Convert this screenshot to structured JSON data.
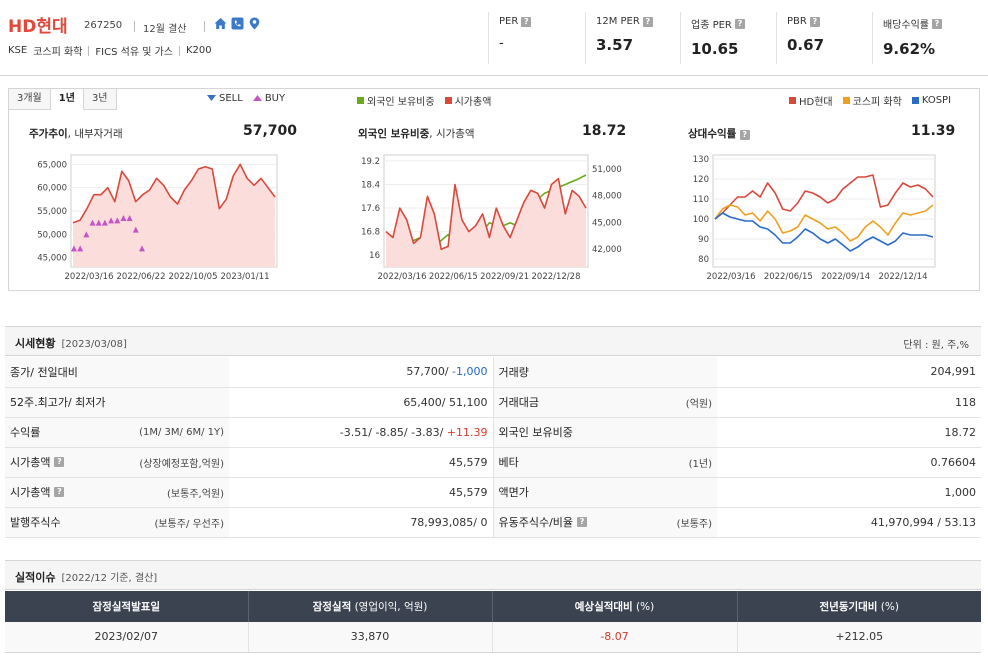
{
  "company": {
    "name": "HD현대",
    "code": "267250",
    "fiscal": "12월 결산",
    "market": "KSE",
    "kospi_sector": "코스피 화학",
    "fics_sector": "FICS 석유 및 가스",
    "index": "K200"
  },
  "metrics": [
    {
      "label": "PER",
      "value": "-"
    },
    {
      "label": "12M PER",
      "value": "3.57"
    },
    {
      "label": "업종 PER",
      "value": "10.65"
    },
    {
      "label": "PBR",
      "value": "0.67"
    },
    {
      "label": "배당수익률",
      "value": "9.62%"
    }
  ],
  "tabs": [
    "3개월",
    "1년",
    "3년"
  ],
  "active_tab": "1년",
  "legends": {
    "chart1": [
      "SELL",
      "BUY"
    ],
    "chart2": [
      "외국인 보유비중",
      "시가총액"
    ],
    "chart3": [
      "HD현대",
      "코스피 화학",
      "KOSPI"
    ]
  },
  "colors": {
    "red": "#d9493b",
    "green": "#6aaa1e",
    "orange": "#f0a020",
    "blue": "#2a6dc7",
    "sell": "#3a6fc8",
    "buy": "#c555c5"
  },
  "charts": {
    "c1": {
      "title_main": "주가추이",
      "title_sub": ", 내부자거래",
      "value": "57,700"
    },
    "c2": {
      "title_main": "외국인 보유비중",
      "title_sub": ", 시가총액",
      "value": "18.72"
    },
    "c3": {
      "title_main": "상대수익률",
      "title_sub": "",
      "value": "11.39"
    }
  },
  "chart_data": [
    {
      "type": "line",
      "title": "주가추이, 내부자거래",
      "x": [
        "2022/03/16",
        "2022/06/22",
        "2022/10/05",
        "2023/01/11"
      ],
      "ylim": [
        43000,
        67000
      ],
      "yticks": [
        "65,000",
        "60,000",
        "55,000",
        "50,000",
        "45,000"
      ],
      "series": [
        {
          "name": "주가",
          "values": [
            52500,
            53000,
            55500,
            58500,
            58500,
            60000,
            57000,
            63500,
            61500,
            57000,
            58500,
            59500,
            62000,
            60500,
            58000,
            56500,
            59500,
            61500,
            64000,
            64500,
            64000,
            55500,
            57500,
            62500,
            65000,
            62000,
            60500,
            62000,
            60000,
            58000
          ]
        },
        {
          "name": "BUY",
          "values": [
            47000,
            47000,
            50000,
            52500,
            52500,
            52500,
            53000,
            53000,
            53500,
            53500,
            51000,
            47000
          ]
        }
      ]
    },
    {
      "type": "line",
      "title": "외국인 보유비중, 시가총액",
      "x": [
        "2022/03/16",
        "2022/06/15",
        "2022/09/21",
        "2022/12/28"
      ],
      "ylim": [
        15.6,
        19.4
      ],
      "yticks": [
        "19.2",
        "18.4",
        "17.6",
        "16.8",
        "16"
      ],
      "y2ticks": [
        "51,000",
        "48,000",
        "45,000",
        "42,000"
      ],
      "series": [
        {
          "name": "외국인 보유비중",
          "values": [
            16.4,
            16.3,
            16.2,
            16.4,
            16.5,
            16.6,
            16.3,
            16.2,
            16.5,
            16.7,
            16.4,
            16.2,
            16.1,
            16.5,
            16.8,
            17.1,
            17.0,
            17.0,
            17.1,
            17.0,
            17.2,
            17.6,
            17.9,
            18.1,
            18.2,
            18.3,
            18.4,
            18.5,
            18.6,
            18.72
          ]
        },
        {
          "name": "시가총액",
          "values": [
            16.8,
            16.6,
            17.6,
            17.2,
            16.4,
            16.6,
            18.0,
            17.4,
            16.2,
            16.3,
            18.4,
            17.2,
            16.8,
            17.0,
            17.4,
            16.6,
            17.6,
            17.0,
            16.6,
            17.2,
            17.8,
            18.2,
            18.1,
            17.6,
            18.4,
            18.6,
            17.4,
            18.2,
            18.0,
            17.6
          ]
        }
      ]
    },
    {
      "type": "line",
      "title": "상대수익률",
      "x": [
        "2022/03/16",
        "2022/06/15",
        "2022/09/14",
        "2022/12/14"
      ],
      "ylim": [
        76,
        132
      ],
      "yticks": [
        "130",
        "120",
        "110",
        "100",
        "90",
        "80"
      ],
      "series": [
        {
          "name": "HD현대",
          "values": [
            100,
            103,
            107,
            111,
            111,
            114,
            111,
            118,
            113,
            105,
            104,
            108,
            114,
            113,
            111,
            108,
            110,
            115,
            118,
            121,
            121,
            122,
            106,
            107,
            113,
            118,
            116,
            117,
            115,
            111
          ]
        },
        {
          "name": "코스피 화학",
          "values": [
            100,
            105,
            107,
            106,
            102,
            103,
            99,
            104,
            100,
            93,
            94,
            96,
            102,
            100,
            98,
            95,
            96,
            93,
            89,
            91,
            96,
            99,
            96,
            92,
            98,
            103,
            102,
            103,
            104,
            107
          ]
        },
        {
          "name": "KOSPI",
          "values": [
            100,
            103,
            101,
            100,
            99,
            99,
            96,
            95,
            92,
            88,
            88,
            91,
            95,
            93,
            90,
            88,
            90,
            87,
            84,
            86,
            89,
            91,
            89,
            87,
            89,
            93,
            92,
            92,
            92,
            91
          ]
        }
      ]
    }
  ],
  "market_section": {
    "title": "시세현황",
    "date": "[2023/03/08]",
    "unit": "단위 : 원, 주,%"
  },
  "market_rows": [
    {
      "l1": "종가/ 전일대비",
      "l1_note": "",
      "l1_q": false,
      "v1a": "57,700/",
      "v1b": "-1,000",
      "v1b_color": "neg",
      "l2": "거래량",
      "l2_note": "",
      "l2_q": false,
      "v2": "204,991"
    },
    {
      "l1": "52주.최고가/ 최저가",
      "l1_note": "",
      "l1_q": false,
      "v1a": "65,400/ 51,100",
      "v1b": "",
      "v1b_color": "",
      "l2": "거래대금",
      "l2_note": "(억원)",
      "l2_q": false,
      "v2": "118"
    },
    {
      "l1": "수익률",
      "l1_note": "(1M/ 3M/ 6M/ 1Y)",
      "l1_q": false,
      "v1a": "-3.51/ -8.85/ -3.83/",
      "v1b": "+11.39",
      "v1b_color": "pos",
      "l2": "외국인 보유비중",
      "l2_note": "",
      "l2_q": false,
      "v2": "18.72"
    },
    {
      "l1": "시가총액",
      "l1_note": "(상장예정포함,억원)",
      "l1_q": true,
      "v1a": "45,579",
      "v1b": "",
      "v1b_color": "",
      "l2": "베타",
      "l2_note": "(1년)",
      "l2_q": false,
      "v2": "0.76604"
    },
    {
      "l1": "시가총액",
      "l1_note": "(보통주,억원)",
      "l1_q": true,
      "v1a": "45,579",
      "v1b": "",
      "v1b_color": "",
      "l2": "액면가",
      "l2_note": "",
      "l2_q": false,
      "v2": "1,000"
    },
    {
      "l1": "발행주식수",
      "l1_note": "(보통주/ 우선주)",
      "l1_q": false,
      "v1a": "78,993,085/ 0",
      "v1b": "",
      "v1b_color": "",
      "l2": "유동주식수/비율",
      "l2_note": "(보통주)",
      "l2_q": true,
      "v2": "41,970,994 / 53.13"
    }
  ],
  "earnings_section": {
    "title": "실적이슈",
    "sub": "[2022/12 기준, 결산]"
  },
  "earnings_table": {
    "headers": [
      {
        "main": "잠정실적발표일",
        "sub": ""
      },
      {
        "main": "잠정실적",
        "sub": " (영업이익, 억원)"
      },
      {
        "main": "예상실적대비",
        "sub": " (%)"
      },
      {
        "main": "전년동기대비",
        "sub": " (%)"
      }
    ],
    "row": [
      "2023/02/07",
      "33,870",
      "-8.07",
      "+212.05"
    ]
  }
}
